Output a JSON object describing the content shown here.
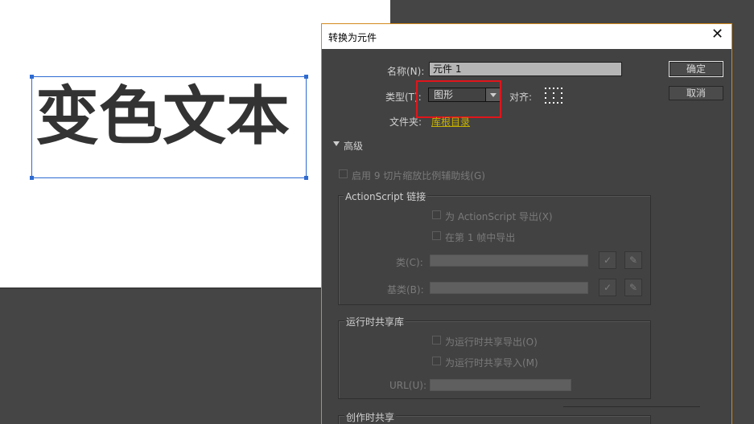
{
  "stage": {
    "text": "变色文本"
  },
  "dialog": {
    "title": "转换为元件",
    "close_glyph": "✕",
    "name_label": "名称(N):",
    "name_value": "元件 1",
    "type_label": "类型(T):",
    "type_value": "图形",
    "align_label": "对齐:",
    "folder_label": "文件夹:",
    "folder_value": "库根目录",
    "ok_label": "确定",
    "cancel_label": "取消",
    "advanced_label": "高级",
    "nine_slice_label": "启用 9 切片缩放比例辅助线(G)",
    "actionscript": {
      "title": "ActionScript 链接",
      "export_label": "为 ActionScript 导出(X)",
      "frame_label": "在第 1 帧中导出",
      "class_label": "类(C):",
      "base_label": "基类(B):",
      "check_glyph": "✓",
      "pencil_glyph": "✎"
    },
    "runtime": {
      "title": "运行时共享库",
      "export_label": "为运行时共享导出(O)",
      "import_label": "为运行时共享导入(M)",
      "url_label": "URL(U):"
    },
    "authoring": {
      "title": "创作时共享"
    }
  },
  "colors": {
    "accent_border": "#d38a1d",
    "highlight_red": "#e0151b",
    "folder_link": "#c8b400",
    "selection_blue": "#2e6bd1"
  }
}
